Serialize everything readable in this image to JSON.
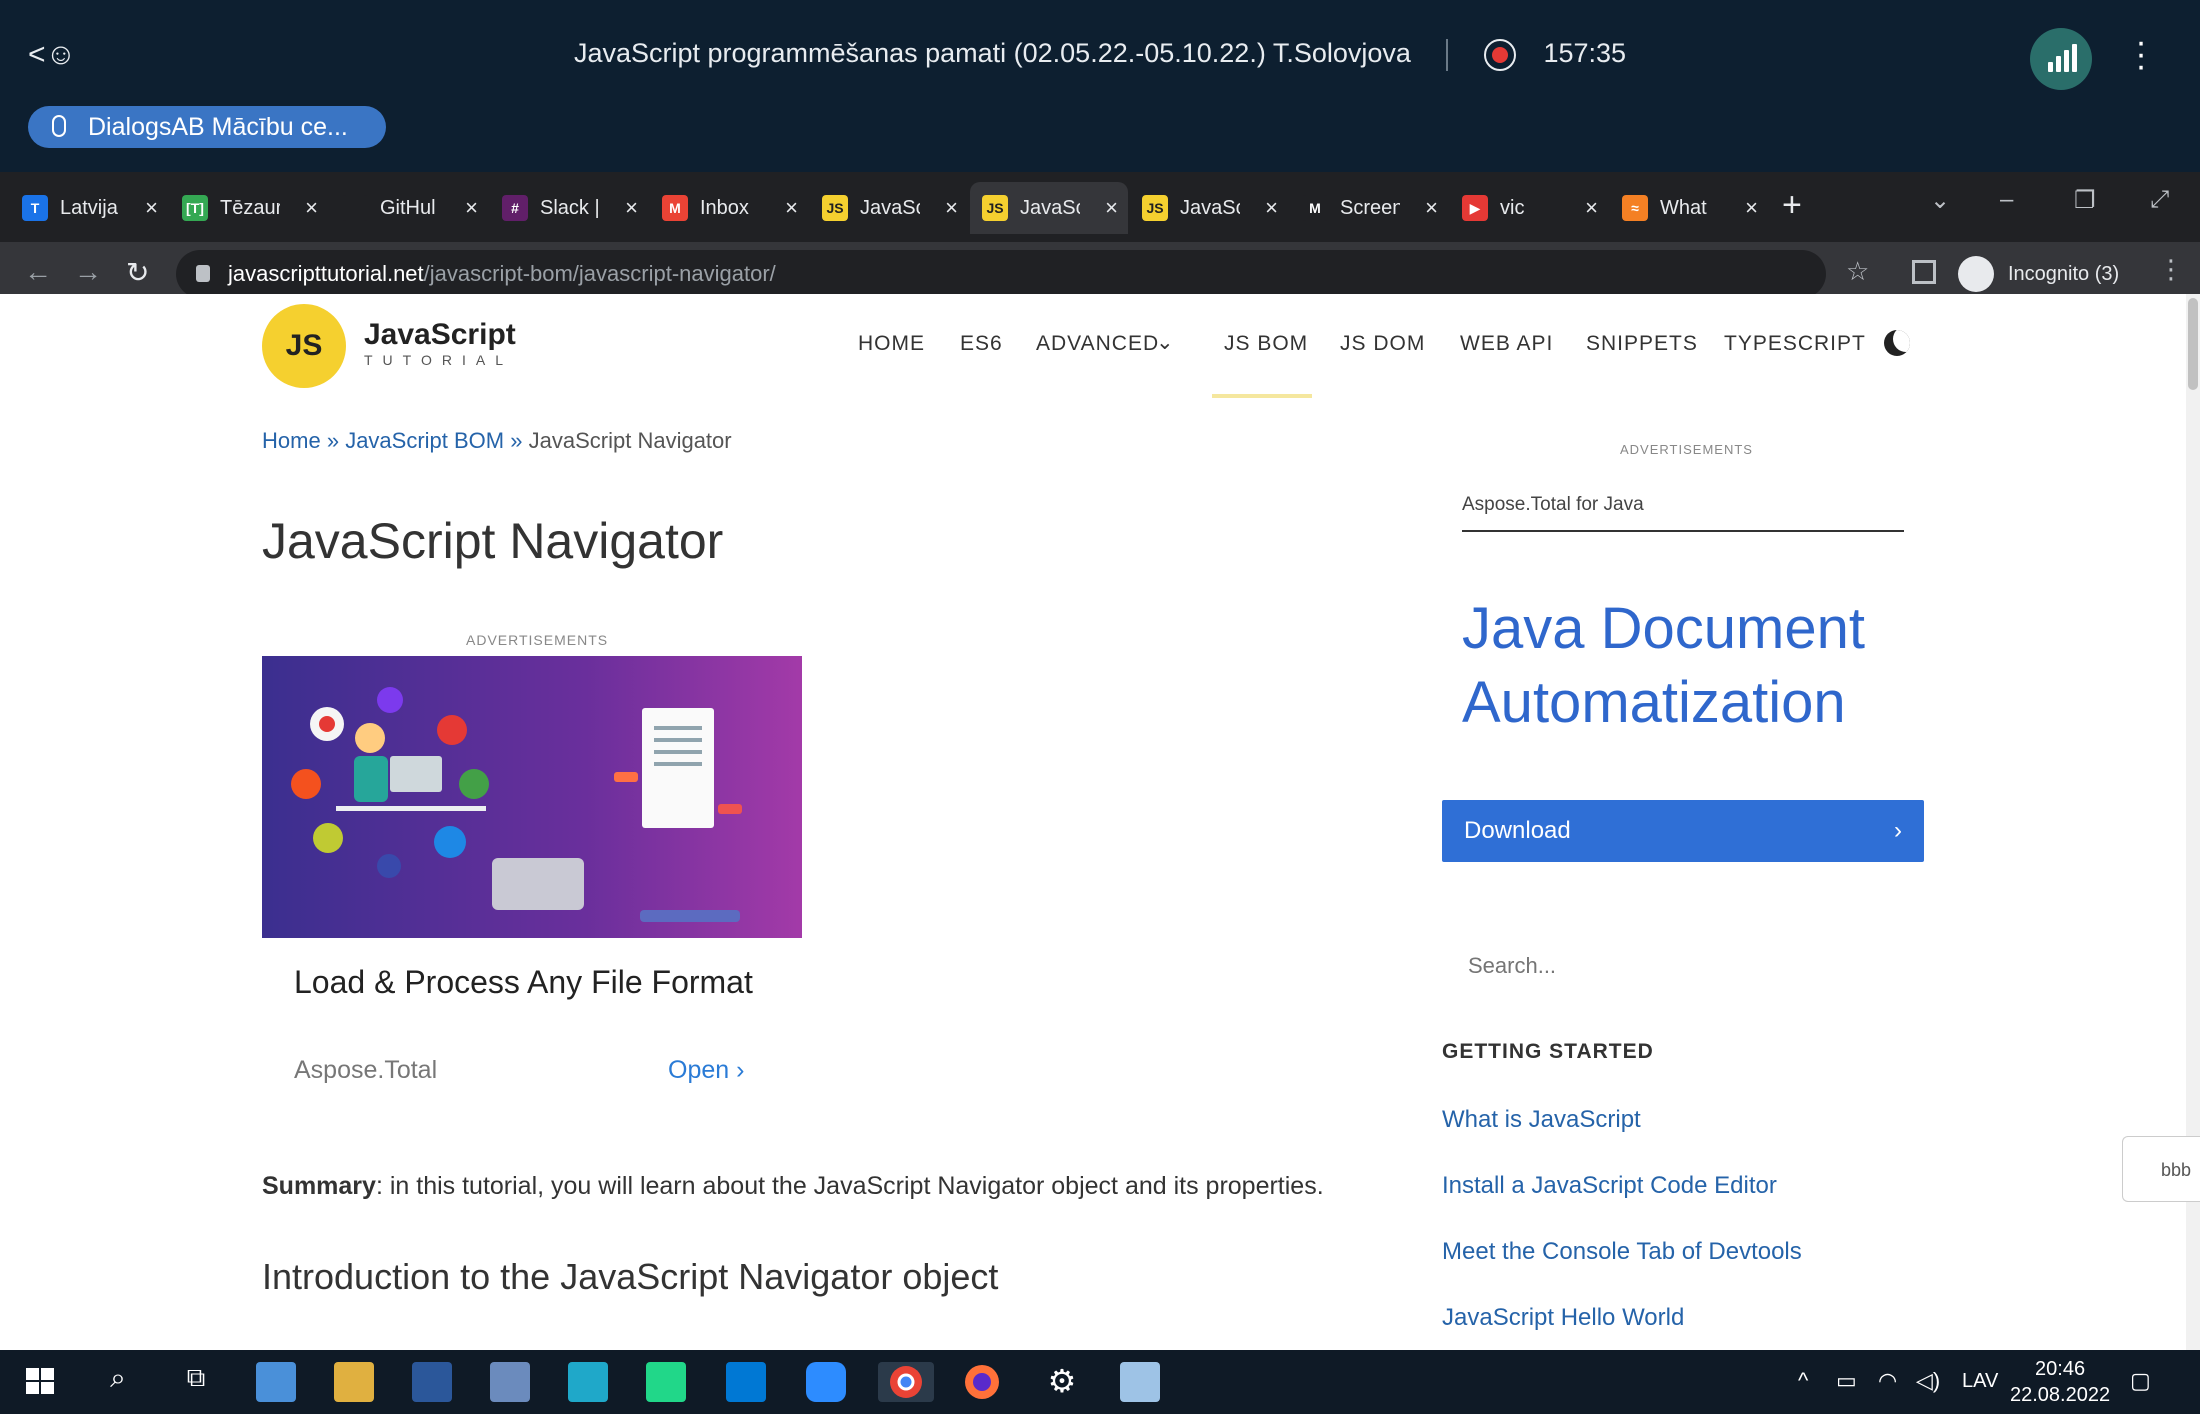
{
  "meeting": {
    "title": "JavaScript programmēšanas pamati (02.05.22.-05.10.22.) T.Solovjova",
    "timer": "157:35",
    "speaker_pill": "DialogsAB Mācību ce..."
  },
  "browser": {
    "tabs": [
      {
        "label": "Latvija",
        "favicon": "T",
        "color": "#1a73e8"
      },
      {
        "label": "Tēzaur",
        "favicon": "[T]",
        "color": "#34a853"
      },
      {
        "label": "GitHul",
        "favicon": "",
        "color": "#202124"
      },
      {
        "label": "Slack |",
        "favicon": "#",
        "color": "#611f69"
      },
      {
        "label": "Inbox",
        "favicon": "M",
        "color": "#ea4335"
      },
      {
        "label": "JavaSc",
        "favicon": "JS",
        "color": "#f5d02f"
      },
      {
        "label": "JavaSc",
        "favicon": "JS",
        "color": "#f5d02f",
        "active": true
      },
      {
        "label": "JavaSc",
        "favicon": "JS",
        "color": "#f5d02f"
      },
      {
        "label": "Screen",
        "favicon": "M",
        "color": "#202124"
      },
      {
        "label": "vic",
        "favicon": "▶",
        "color": "#e53935"
      },
      {
        "label": "What",
        "favicon": "≈",
        "color": "#f48024"
      }
    ],
    "url_host": "javascripttutorial.net",
    "url_path": "/javascript-bom/javascript-navigator/",
    "incognito_label": "Incognito (3)"
  },
  "site": {
    "logo_mark": "JS",
    "logo_title": "JavaScript",
    "logo_sub": "TUTORIAL",
    "nav": [
      "HOME",
      "ES6",
      "ADVANCED",
      "JS BOM",
      "JS DOM",
      "WEB API",
      "SNIPPETS",
      "TYPESCRIPT"
    ],
    "active_nav": "JS BOM"
  },
  "breadcrumb": {
    "home": "Home",
    "sep1": "»",
    "section": "JavaScript BOM",
    "sep2": "»",
    "current": "JavaScript Navigator"
  },
  "article": {
    "title": "JavaScript Navigator",
    "summary_label": "Summary",
    "summary_text": ": in this tutorial, you will learn about the JavaScript Navigator object and its properties.",
    "subheading": "Introduction to the JavaScript Navigator object"
  },
  "ad_main": {
    "label": "ADVERTISEMENTS",
    "title": "Load & Process Any File Format",
    "brand": "Aspose.Total",
    "cta": "Open"
  },
  "ad_side": {
    "label": "ADVERTISEMENTS",
    "product": "Aspose.Total for Java",
    "headline": "Java Document Automatization",
    "button": "Download"
  },
  "sidebar": {
    "search_placeholder": "Search...",
    "section_title": "GETTING STARTED",
    "links": [
      "What is JavaScript",
      "Install a JavaScript Code Editor",
      "Meet the Console Tab of Devtools",
      "JavaScript Hello World"
    ]
  },
  "floating_tab": "bbb",
  "taskbar": {
    "lang": "LAV",
    "time": "20:46",
    "date": "22.08.2022"
  }
}
